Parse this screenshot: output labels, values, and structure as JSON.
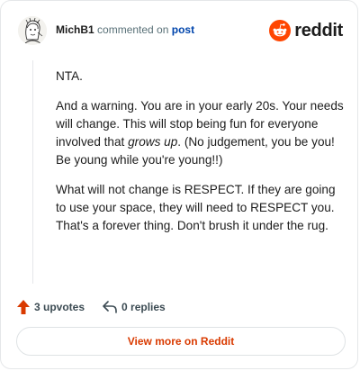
{
  "header": {
    "username": "MichB1",
    "action_text": " commented on ",
    "post_link": "post",
    "brand_name": "reddit",
    "brand_color": "#ff4500"
  },
  "comment": {
    "p1": "NTA.",
    "p2_before": "And a warning. You are in your early 20s. Your needs will change. This will stop being fun for everyone involved that ",
    "p2_em": "grows up",
    "p2_after": ". (No judgement, you be you! Be young while you're young!!)",
    "p3": "What will not change is RESPECT. If they are going to use your space, they will need to RESPECT you. That's a forever thing. Don't brush it under the rug."
  },
  "actions": {
    "upvotes_label": "3 upvotes",
    "upvote_icon": "upvote-arrow-icon",
    "upvote_color": "#d93a00",
    "replies_label": "0 replies",
    "reply_icon": "reply-icon"
  },
  "footer": {
    "view_more_label": "View more on Reddit",
    "view_more_color": "#d93a00"
  }
}
